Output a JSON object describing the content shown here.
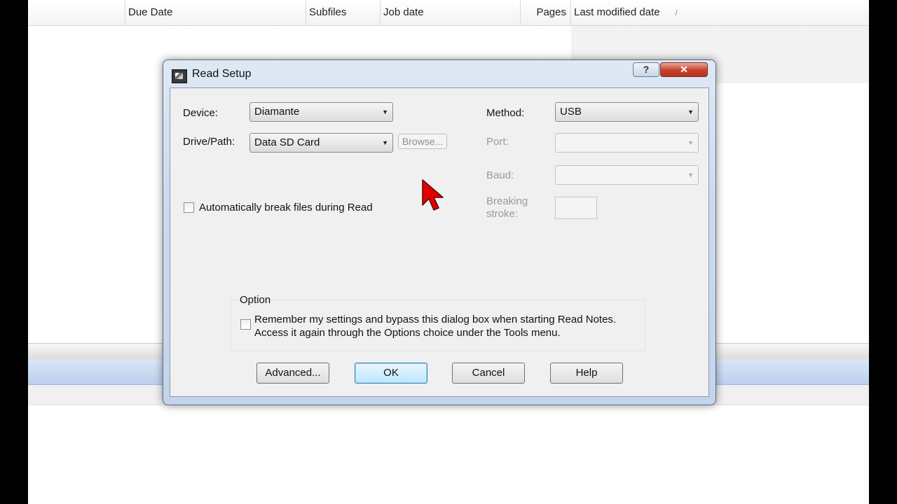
{
  "columns": [
    "Due Date",
    "Subfiles",
    "Job date",
    "Pages",
    "Last modified date"
  ],
  "sort_indicator": "/",
  "dialog": {
    "title": "Read Setup",
    "help_glyph": "?",
    "close_glyph": "✕",
    "device_label": "Device:",
    "device_value": "Diamante",
    "drive_label": "Drive/Path:",
    "drive_value": "Data SD Card",
    "browse_label": "Browse...",
    "auto_break_label": "Automatically break files during Read",
    "method_label": "Method:",
    "method_value": "USB",
    "port_label": "Port:",
    "baud_label": "Baud:",
    "breaking_label_1": "Breaking",
    "breaking_label_2": "stroke:",
    "option_title": "Option",
    "option_line1": "Remember my settings and bypass this dialog box when starting Read Notes.",
    "option_line2": "Access it again through the Options choice under the Tools menu.",
    "buttons": {
      "advanced": "Advanced...",
      "ok": "OK",
      "cancel": "Cancel",
      "help": "Help"
    }
  },
  "icons": {
    "app": "steno-machine-icon",
    "cursor": "mouse-pointer-icon",
    "dropdown": "chevron-down-icon"
  },
  "colors": {
    "selection_row": "#bcd0ec",
    "close_button": "#c7402c",
    "cursor": "#e00000"
  }
}
